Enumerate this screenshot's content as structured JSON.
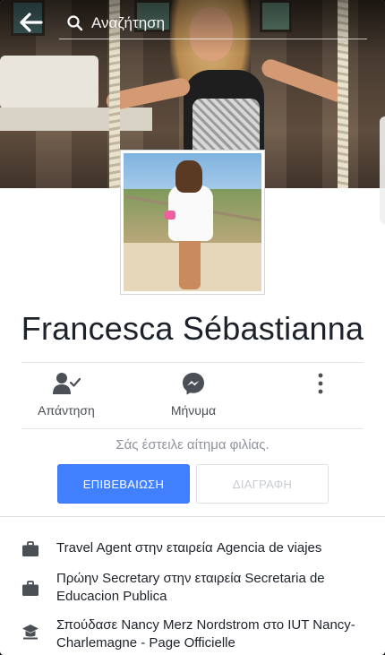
{
  "search": {
    "placeholder": "Αναζήτηση"
  },
  "profile": {
    "name": "Francesca Sébastianna"
  },
  "actions": [
    {
      "label": "Απάντηση",
      "icon": "person-check-icon"
    },
    {
      "label": "Μήνυμα",
      "icon": "messenger-icon"
    },
    {
      "label": "",
      "icon": "more-vertical-icon"
    }
  ],
  "friend_request": {
    "text": "Σάς έστειλε αίτημα φιλίας.",
    "confirm_label": "ΕΠΙΒΕΒΑΙΩΣΗ",
    "delete_label": "ΔΙΑΓΡΑΦΗ"
  },
  "info": [
    {
      "icon": "briefcase-icon",
      "text": "Travel Agent στην εταιρεία Agencia de viajes"
    },
    {
      "icon": "briefcase-icon",
      "text": "Πρώην Secretary στην εταιρεία Secretaria de Educacion Publica"
    },
    {
      "icon": "graduation-cap-icon",
      "text": "Σπούδασε Nancy Merz Nordstrom στο IUT Nancy-Charlemagne - Page Officielle"
    }
  ],
  "colors": {
    "accent": "#4080ff",
    "text": "#1d2129",
    "muted": "#90949c",
    "icon": "#4b4f56"
  }
}
